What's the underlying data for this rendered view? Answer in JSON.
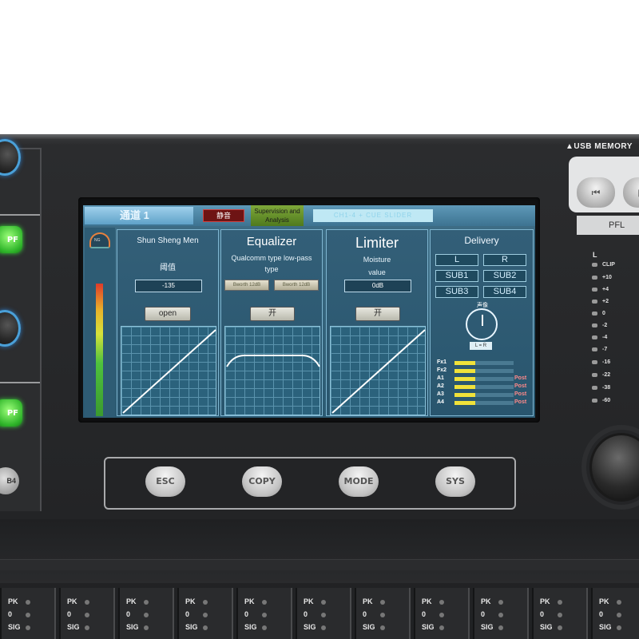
{
  "header": {
    "usb_label": "▲USB MEMORY",
    "pfl_label": "PFL"
  },
  "screen": {
    "tabs": {
      "channel": "通道 1",
      "mute": "静音",
      "monitor": "Supervision and Analysis",
      "link": "CH1-4 + CUE SLIDER"
    },
    "gauge_label": "NG",
    "gate_panel": {
      "title": "Shun Sheng Men",
      "threshold_label": "阈值",
      "threshold_value": "-135",
      "switch_label": "open"
    },
    "eq_panel": {
      "title": "Equalizer",
      "subtitle": "Qualcomm type low-pass type",
      "button_left": "Bworth 12dB",
      "button_right": "Bworth 12dB",
      "switch_label": "开"
    },
    "limiter_panel": {
      "title": "Limiter",
      "subtitle_1": "Moisture",
      "subtitle_2": "value",
      "value": "0dB",
      "switch_label": "开"
    },
    "delivery_panel": {
      "title": "Delivery",
      "routes": [
        "L",
        "R",
        "SUB1",
        "SUB2",
        "SUB3",
        "SUB4"
      ],
      "stopwatch_label": "声像",
      "lr_tag": "L = R",
      "sends": [
        {
          "label": "Fx1",
          "fill": 0.35,
          "post": ""
        },
        {
          "label": "Fx2",
          "fill": 0.35,
          "post": ""
        },
        {
          "label": "A1",
          "fill": 0.35,
          "post": "Post"
        },
        {
          "label": "A2",
          "fill": 0.35,
          "post": "Post"
        },
        {
          "label": "A3",
          "fill": 0.35,
          "post": "Post"
        },
        {
          "label": "A4",
          "fill": 0.35,
          "post": "Post"
        }
      ]
    }
  },
  "left_controls": {
    "pf_label_1": "PF",
    "pf_label_2": "PF",
    "sub_label": "B4"
  },
  "nav_buttons": [
    "ESC",
    "COPY",
    "MODE",
    "SYS"
  ],
  "usb_buttons": [
    "⏮",
    "▶"
  ],
  "meter": {
    "channel": "L",
    "rows": [
      "CLIP",
      "+10",
      "+4",
      "+2",
      "0",
      "-2",
      "-4",
      "-7",
      "-16",
      "-22",
      "-38",
      "-60"
    ]
  },
  "channel_strips": {
    "labels": [
      "PK",
      "0",
      "SIG"
    ]
  },
  "colors": {
    "screen_blue": "#2b5a72",
    "mute_red": "#6e1414",
    "pf_green": "#2fb52a",
    "knob_ring_blue": "#4aa0d8"
  }
}
